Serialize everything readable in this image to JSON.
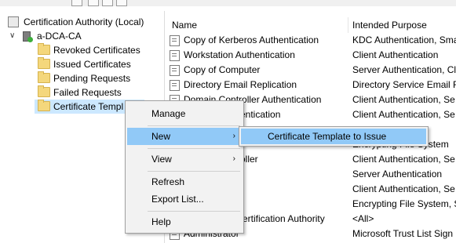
{
  "tree": {
    "root": "Certification Authority (Local)",
    "ca": "a-DCA-CA",
    "folders": [
      "Revoked Certificates",
      "Issued Certificates",
      "Pending Requests",
      "Failed Requests",
      "Certificate Templ"
    ]
  },
  "list": {
    "columns": [
      "Name",
      "Intended Purpose"
    ],
    "rows": [
      {
        "name": "Copy of Kerberos Authentication",
        "purpose": "KDC Authentication, Sma"
      },
      {
        "name": "Workstation Authentication",
        "purpose": "Client Authentication"
      },
      {
        "name": "Copy of Computer",
        "purpose": "Server Authentication, Cl"
      },
      {
        "name": "Directory Email Replication",
        "purpose": "Directory Service Email Re"
      },
      {
        "name": "Domain Controller Authentication",
        "purpose": "Client Authentication, Se"
      },
      {
        "name": "entication",
        "purpose": "Client Authentication, Se"
      },
      {
        "name": "",
        "purpose": "Encrypting File System"
      },
      {
        "name": "oller",
        "purpose": "Client Authentication, Se"
      },
      {
        "name": "",
        "purpose": "Server Authentication"
      },
      {
        "name": "",
        "purpose": "Client Authentication, Se"
      },
      {
        "name": "",
        "purpose": "Encrypting File System, Se"
      },
      {
        "name": "ertification Authority",
        "purpose": "<All>"
      },
      {
        "name": "Administrator",
        "purpose": "Microsoft Trust List Sign"
      }
    ]
  },
  "context_menu": {
    "manage": "Manage",
    "new": "New",
    "view": "View",
    "refresh": "Refresh",
    "export": "Export List...",
    "help": "Help",
    "submenu_arrow": "›"
  },
  "submenu": {
    "item": "Certificate Template to Issue"
  },
  "colors": {
    "highlight": "#91c9f7",
    "selection": "#cce8ff"
  }
}
